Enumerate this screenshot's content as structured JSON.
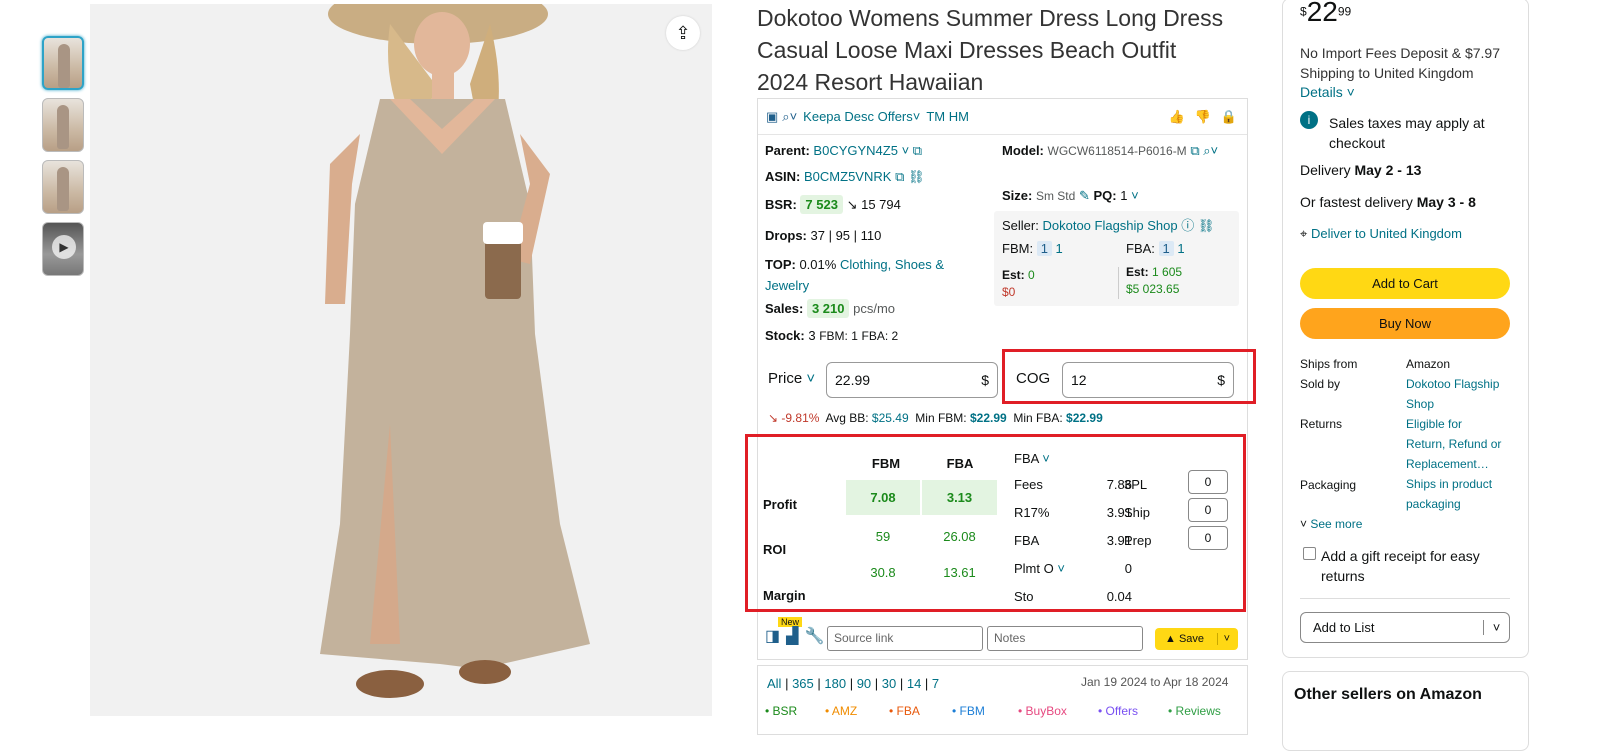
{
  "share_icon": "share-icon",
  "product": {
    "title_line1": "Dokotoo Womens Summer Dress Long Dress",
    "title_line2": "Casual Loose Maxi Dresses Beach Outfit",
    "title_line3": "2024 Resort Hawaiian"
  },
  "keepa": {
    "toolbar": {
      "offers_label": "Keepa Desc Offers",
      "tm_label": "TM HM"
    },
    "parent_label": "Parent:",
    "parent_value": "B0CYGYN4Z5",
    "asin_label": "ASIN:",
    "asin_value": "B0CMZ5VNRK",
    "bsr_label": "BSR:",
    "bsr_value": "7 523",
    "bsr_trend": "↘ 15 794",
    "drops_label": "Drops:",
    "drops_value": "37 | 95 | 110",
    "top_label": "TOP:",
    "top_value": "0.01%",
    "top_category_1": "Clothing, Shoes &",
    "top_category_2": "Jewelry",
    "sales_label": "Sales:",
    "sales_value": "3 210",
    "sales_unit": "pcs/mo",
    "stock_label": "Stock:",
    "stock_value": "3",
    "stock_fbm": "FBM: 1",
    "stock_fba": "FBA: 2",
    "model_label": "Model:",
    "model_value": "WGCW6118514-P6016-M",
    "size_label": "Size:",
    "size_value": "Sm Std",
    "pq_label": "PQ:",
    "pq_value": "1",
    "seller_label": "Seller:",
    "seller_value": "Dokotoo Flagship Shop",
    "fbm_label": "FBM:",
    "fbm_n1": "1",
    "fbm_n2": "1",
    "fba_label": "FBA:",
    "fba_n1": "1",
    "fba_n2": "1",
    "est_fbm_label": "Est:",
    "est_fbm_value": "0",
    "est_fbm_money": "$0",
    "est_fba_label": "Est:",
    "est_fba_value": "1 605",
    "est_fba_money": "$5 023.65",
    "price_label": "Price",
    "price_value": "22.99",
    "price_unit": "$",
    "cog_label": "COG",
    "cog_value": "12",
    "cog_unit": "$",
    "change": "↘ -9.81%",
    "avg_bb_label": "Avg BB:",
    "avg_bb_value": "$25.49",
    "min_fbm_label": "Min FBM:",
    "min_fbm_value": "$22.99",
    "min_fba_label": "Min FBA:",
    "min_fba_value": "$22.99",
    "table": {
      "col_fbm": "FBM",
      "col_fba": "FBA",
      "row_profit": "Profit",
      "row_roi": "ROI",
      "row_margin": "Margin",
      "profit_fbm": "7.08",
      "profit_fba": "3.13",
      "roi_fbm": "59",
      "roi_fba": "26.08",
      "margin_fbm": "30.8",
      "margin_fba": "13.61"
    },
    "fees_mode": "FBA",
    "fees": [
      {
        "label": "Fees",
        "value": "7.86"
      },
      {
        "label": "R17%",
        "value": "3.91"
      },
      {
        "label": "FBA",
        "value": "3.91"
      },
      {
        "label": "Plmt O",
        "value": "0"
      },
      {
        "label": "Sto",
        "value": "0.04"
      }
    ],
    "extra_costs": [
      {
        "label": "3PL",
        "value": "0"
      },
      {
        "label": "Ship",
        "value": "0"
      },
      {
        "label": "Prep",
        "value": "0"
      }
    ],
    "new_tag": "New",
    "source_placeholder": "Source link",
    "notes_placeholder": "Notes",
    "save_label": "Save",
    "ranges": [
      "All",
      "365",
      "180",
      "90",
      "30",
      "14",
      "7"
    ],
    "date_range": "Jan 19 2024 to Apr 18 2024",
    "legend": [
      {
        "label": "BSR",
        "color": "#1b8a1b"
      },
      {
        "label": "AMZ",
        "color": "#f08c00"
      },
      {
        "label": "FBA",
        "color": "#e8590c"
      },
      {
        "label": "FBM",
        "color": "#1c7ed6"
      },
      {
        "label": "BuyBox",
        "color": "#e64980"
      },
      {
        "label": "Offers",
        "color": "#7950f2"
      },
      {
        "label": "Reviews",
        "color": "#2f9e44"
      }
    ]
  },
  "buybox": {
    "currency": "$",
    "price_whole": "22",
    "price_fraction": "99",
    "import_fees_1": "No Import Fees Deposit & $7.97",
    "import_fees_2": "Shipping to United Kingdom",
    "details_link": "Details",
    "tax_note_1": "Sales taxes may apply at",
    "tax_note_2": "checkout",
    "delivery_label": "Delivery",
    "delivery_dates": "May 2 - 13",
    "fastest_label": "Or fastest delivery",
    "fastest_dates": "May 3 - 8",
    "deliver_to": "Deliver to United Kingdom",
    "add_to_cart": "Add to Cart",
    "buy_now": "Buy Now",
    "ships_from_label": "Ships from",
    "ships_from_value": "Amazon",
    "sold_by_label": "Sold by",
    "sold_by_value_1": "Dokotoo Flagship",
    "sold_by_value_2": "Shop",
    "returns_label": "Returns",
    "returns_value_1": "Eligible for",
    "returns_value_2": "Return, Refund or",
    "returns_value_3": "Replacement…",
    "packaging_label": "Packaging",
    "packaging_value_1": "Ships in product",
    "packaging_value_2": "packaging",
    "see_more": "See more",
    "gift_receipt_1": "Add a gift receipt for easy",
    "gift_receipt_2": "returns",
    "add_to_list": "Add to List",
    "other_sellers": "Other sellers on Amazon"
  }
}
